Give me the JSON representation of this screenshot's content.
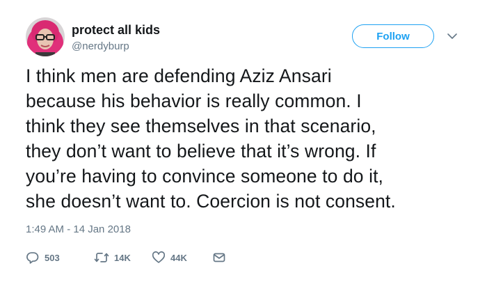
{
  "user": {
    "display_name": "protect all kids",
    "handle": "@nerdyburp"
  },
  "follow_label": "Follow",
  "tweet_lines": [
    "I think men are defending Aziz Ansari",
    "because his behavior is really common. I",
    "think they see themselves in that scenario,",
    "they don’t want to believe that it’s wrong. If",
    "you’re having to convince someone to do it,",
    "she doesn’t want to. Coercion is not consent."
  ],
  "timestamp": "1:49 AM - 14 Jan 2018",
  "actions": {
    "reply_count": "503",
    "retweet_count": "14K",
    "like_count": "44K"
  },
  "colors": {
    "accent": "#1da1f2",
    "text": "#14171a",
    "secondary_text": "#657786",
    "avatar_hair": "#e0307a"
  },
  "icons": [
    "reply-icon",
    "retweet-icon",
    "like-icon",
    "direct-message-icon",
    "chevron-down-icon"
  ]
}
